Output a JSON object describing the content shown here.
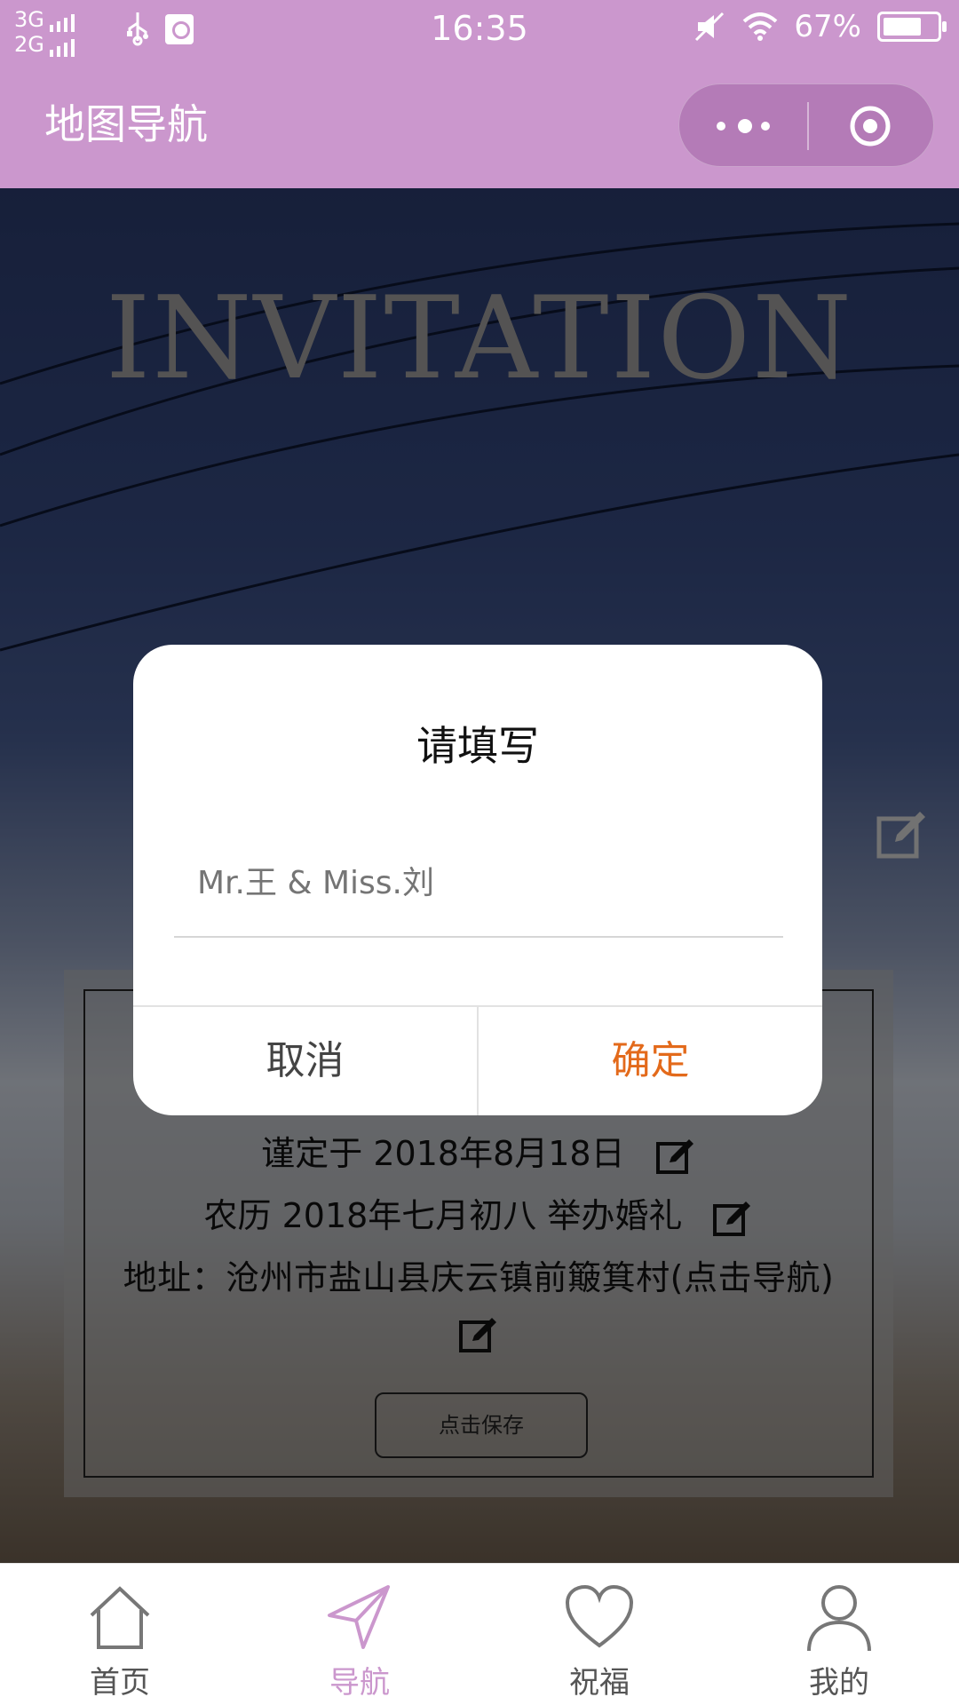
{
  "status_bar": {
    "network_top": "3G",
    "network_bottom": "2G",
    "time": "16:35",
    "battery": "67%"
  },
  "nav": {
    "title": "地图导航"
  },
  "background": {
    "heading": "INVITATION"
  },
  "card": {
    "line1": "谨定于 2018年8月18日",
    "line2": "农历 2018年七月初八 举办婚礼",
    "line3": "地址：沧州市盐山县庆云镇前簸箕村(点击导航)",
    "save_label": "点击保存"
  },
  "dialog": {
    "title": "请填写",
    "input_placeholder": "Mr.王 & Miss.刘",
    "cancel_label": "取消",
    "confirm_label": "确定"
  },
  "tabbar": {
    "items": [
      {
        "label": "首页",
        "icon": "home-icon"
      },
      {
        "label": "导航",
        "icon": "navigation-icon",
        "active": true
      },
      {
        "label": "祝福",
        "icon": "heart-icon"
      },
      {
        "label": "我的",
        "icon": "user-icon"
      }
    ]
  },
  "colors": {
    "accent": "#cb97cd",
    "confirm": "#e36a1b"
  }
}
